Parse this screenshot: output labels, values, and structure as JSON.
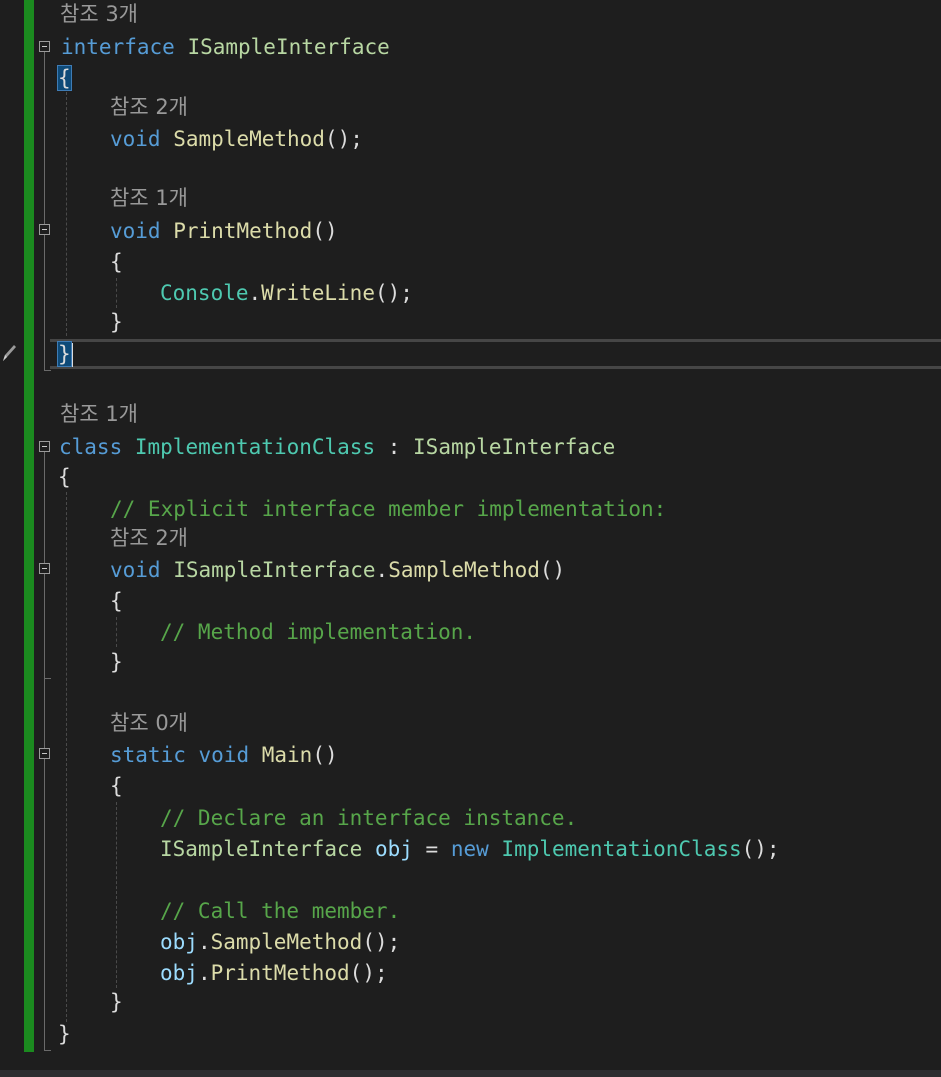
{
  "editor": {
    "lens": {
      "refs3": "참조 3개",
      "refs2_a": "참조 2개",
      "refs1_a": "참조 1개",
      "refs1_b": "참조 1개",
      "refs2_b": "참조 2개",
      "refs0": "참조 0개"
    },
    "tokens": {
      "kw_interface": "interface",
      "iface_name": "ISampleInterface",
      "brace_open": "{",
      "brace_close": "}",
      "kw_void": "void",
      "kw_static": "static",
      "kw_class": "class",
      "kw_new": "new",
      "sample_method": "SampleMethod",
      "print_method": "PrintMethod",
      "main_method": "Main",
      "parens": "()",
      "parens_semi": "();",
      "console": "Console",
      "dot": ".",
      "writeline": "WriteLine",
      "class_name": "ImplementationClass",
      "colon": " : ",
      "obj": "obj",
      "assign": " = ",
      "space": " "
    },
    "comments": {
      "explicit": "// Explicit interface member implementation:",
      "method_impl": "// Method implementation.",
      "declare": "// Declare an interface instance.",
      "call": "// Call the member."
    },
    "icons": {
      "fold": "collapse-icon",
      "edit": "pencil-icon"
    },
    "colors": {
      "keyword": "#569cd6",
      "type": "#4ec9b0",
      "interface": "#b8d7a3",
      "method": "#dcdcaa",
      "variable": "#9cdcfe",
      "comment": "#57a64a",
      "codelens": "#999999",
      "change_bar": "#1b8a1f",
      "background": "#1e1e1e"
    }
  }
}
